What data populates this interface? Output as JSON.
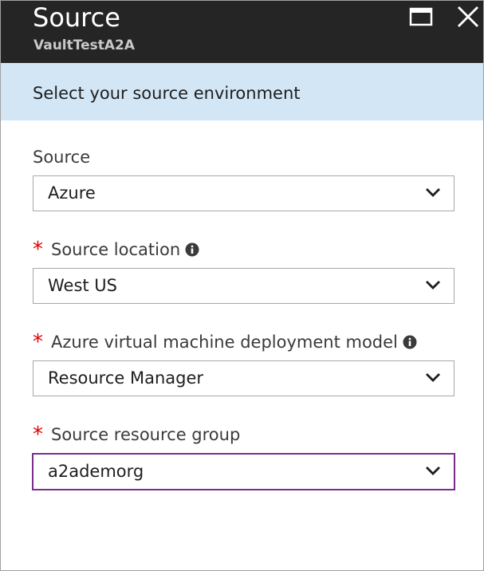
{
  "header": {
    "title": "Source",
    "subtitle": "VaultTestA2A"
  },
  "banner": {
    "text": "Select your source environment"
  },
  "fields": {
    "source": {
      "label": "Source",
      "required": false,
      "value": "Azure"
    },
    "source_location": {
      "label": "Source location",
      "required": true,
      "required_marker": "*",
      "value": "West US",
      "has_info": true
    },
    "deployment_model": {
      "label": "Azure virtual machine deployment model",
      "required": true,
      "required_marker": "*",
      "value": "Resource Manager",
      "has_info": true
    },
    "resource_group": {
      "label": "Source resource group",
      "required": true,
      "required_marker": "*",
      "value": "a2ademorg",
      "focused": true
    }
  },
  "icons": {
    "maximize": "maximize-icon",
    "close": "close-icon",
    "info": "info-icon",
    "chevron": "chevron-down-icon"
  },
  "colors": {
    "header_bg": "#252525",
    "banner_bg": "#d2e6f6",
    "required": "#e00000",
    "focus_border": "#7a2c8f"
  }
}
